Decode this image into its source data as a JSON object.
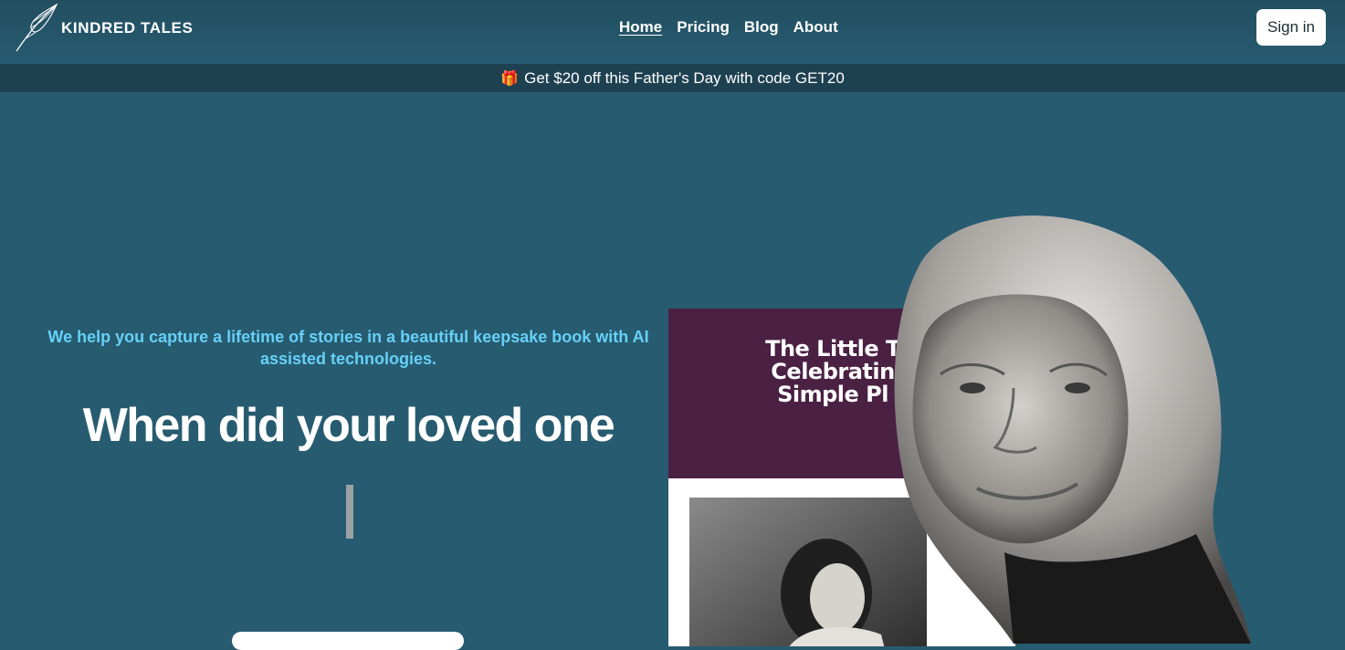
{
  "brand": {
    "name": "KINDRED TALES",
    "logo_icon": "feather-icon"
  },
  "nav": {
    "links": [
      {
        "label": "Home",
        "active": true
      },
      {
        "label": "Pricing",
        "active": false
      },
      {
        "label": "Blog",
        "active": false
      },
      {
        "label": "About",
        "active": false
      }
    ],
    "signin_label": "Sign in"
  },
  "promo": {
    "icon": "gift-icon",
    "text": "Get $20 off this Father's Day with code GET20"
  },
  "hero": {
    "tagline": "We help you capture a lifetime of stories in a beautiful keepsake book with AI assisted technologies.",
    "headline": "When did your loved one"
  },
  "book": {
    "title_lines": [
      "The Little T",
      "Celebratin",
      "Simple Pl"
    ]
  },
  "colors": {
    "background": "#275b70",
    "promo_bar": "#1e4152",
    "tagline": "#66d0f7",
    "book_cover": "#4a2043"
  }
}
